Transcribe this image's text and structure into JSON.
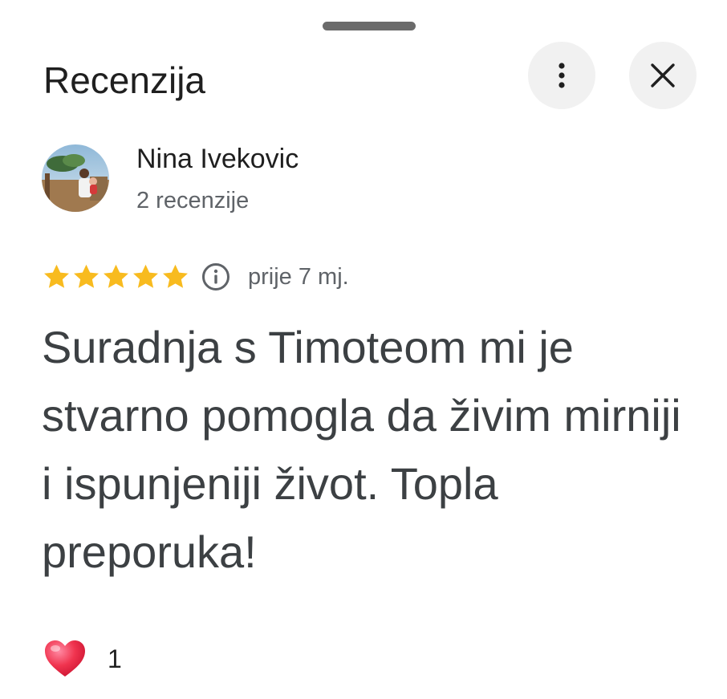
{
  "header": {
    "title": "Recenzija",
    "more_icon": "more-vertical-icon",
    "close_icon": "close-icon"
  },
  "author": {
    "name": "Nina Ivekovic",
    "review_count": "2 recenzije",
    "avatar": "profile-photo"
  },
  "review": {
    "rating": 5,
    "max_rating": 5,
    "star_color": "#F8BB1F",
    "info_icon": "info-icon",
    "time": "prije 7 mj.",
    "text": "Suradnja s Timoteom mi je stvarno pomogla da živim mirniji i ispunjeniji život. Topla preporuka!"
  },
  "reactions": {
    "icon": "heart-icon",
    "count": "1"
  }
}
